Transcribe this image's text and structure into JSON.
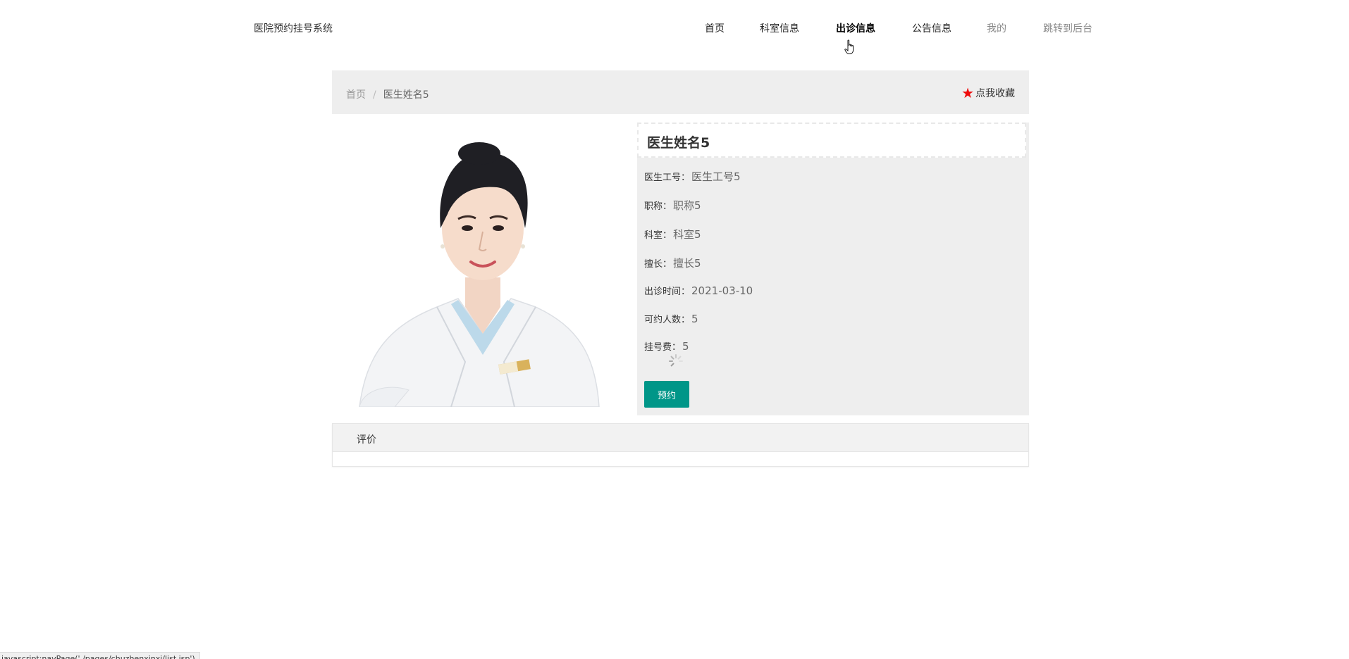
{
  "header": {
    "site_title": "医院预约挂号系统",
    "nav": [
      {
        "label": "首页"
      },
      {
        "label": "科室信息"
      },
      {
        "label": "出诊信息"
      },
      {
        "label": "公告信息"
      },
      {
        "label": "我的"
      },
      {
        "label": "跳转到后台"
      }
    ]
  },
  "breadcrumb": {
    "home": "首页",
    "separator": "/",
    "current": "医生姓名5",
    "collect_label": "点我收藏"
  },
  "doctor": {
    "name": "医生姓名5",
    "fields": [
      {
        "label": "医生工号：",
        "value": "医生工号5"
      },
      {
        "label": "职称：",
        "value": "职称5"
      },
      {
        "label": "科室：",
        "value": "科室5"
      },
      {
        "label": "擅长：",
        "value": "擅长5"
      },
      {
        "label": "出诊时间：",
        "value": "2021-03-10"
      },
      {
        "label": "可约人数：",
        "value": "5"
      },
      {
        "label": "挂号费：",
        "value": "5"
      }
    ],
    "book_button": "预约"
  },
  "review": {
    "tab_label": "评价"
  },
  "status_bar": {
    "text": "javascript:navPage('./pages/chuzhenxinxi/list.jsp')"
  },
  "colors": {
    "accent": "#009688",
    "star": "#ee0a0a",
    "panel_bg": "#eeeeee"
  }
}
